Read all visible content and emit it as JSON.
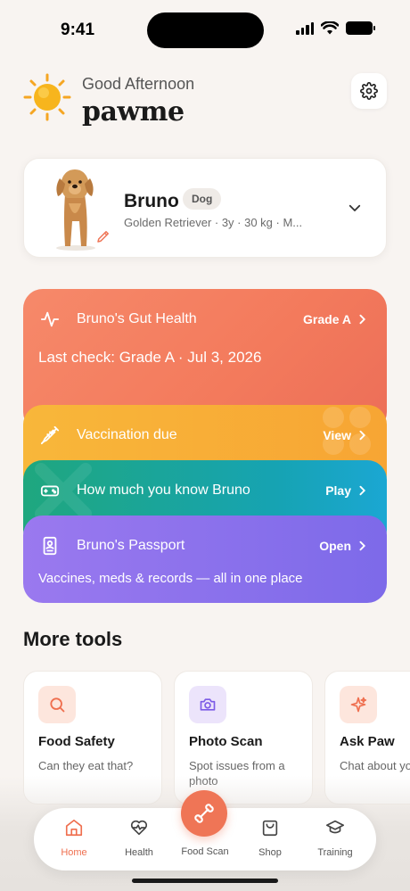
{
  "status": {
    "time": "9:41"
  },
  "header": {
    "greeting": "Good Afternoon",
    "brand": "pawme",
    "sun_icon": "sun-icon",
    "settings_icon": "gear-icon"
  },
  "pet": {
    "name": "Bruno",
    "species_badge": "Dog",
    "meta": "Golden Retriever  ·  3y  ·  30 kg  ·  M...",
    "edit_icon": "pencil-icon"
  },
  "cards": {
    "gut": {
      "title": "Bruno's Gut Health",
      "action": "Grade A",
      "subtitle": "Last check: Grade A · Jul 3, 2026"
    },
    "vaccination": {
      "title": "Vaccination due",
      "action": "View"
    },
    "quiz": {
      "title": "How much you know Bruno",
      "action": "Play"
    },
    "passport": {
      "title": "Bruno's Passport",
      "action": "Open",
      "subtitle": "Vaccines, meds & records — all in one place"
    }
  },
  "tools": {
    "title": "More tools",
    "items": [
      {
        "name": "Food Safety",
        "desc": "Can they eat that?"
      },
      {
        "name": "Photo Scan",
        "desc": "Spot issues from a photo"
      },
      {
        "name": "Ask Paw",
        "desc": "Chat about your pet"
      }
    ]
  },
  "nav": {
    "items": [
      {
        "label": "Home"
      },
      {
        "label": "Health"
      },
      {
        "label": "Food Scan"
      },
      {
        "label": "Shop"
      },
      {
        "label": "Training"
      }
    ]
  },
  "colors": {
    "accent": "#ef7556",
    "gut": "#f37a5c",
    "vaccination": "#f8b73a",
    "quiz": "#16a3b3",
    "passport": "#8b72ec"
  }
}
